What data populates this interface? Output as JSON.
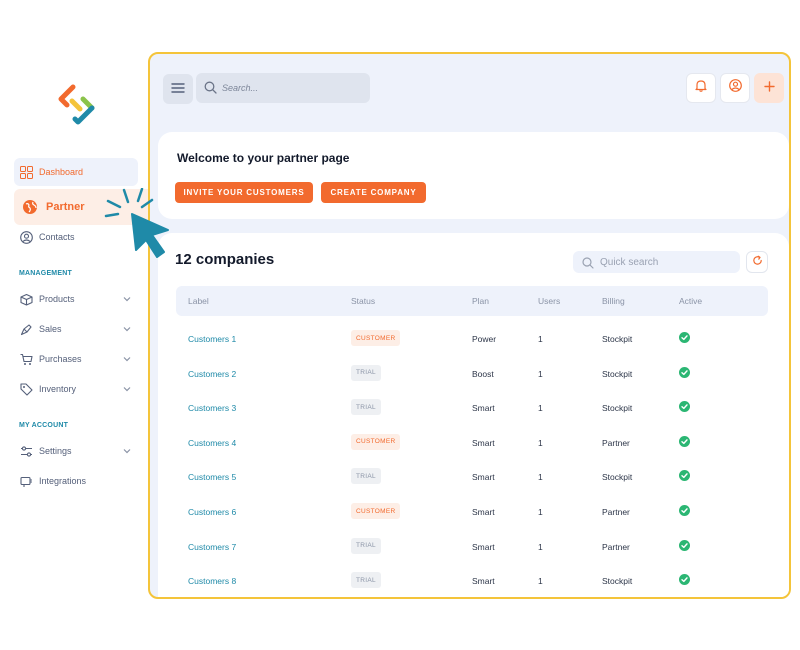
{
  "sidebar": {
    "items": [
      {
        "label": "Dashboard",
        "icon": "grid-icon",
        "active": true
      },
      {
        "label": "Partner",
        "icon": "globe-icon",
        "selected": true
      },
      {
        "label": "Contacts",
        "icon": "user-circle-icon",
        "has_chevron": true
      }
    ],
    "management_title": "MANAGEMENT",
    "management_items": [
      {
        "label": "Products",
        "icon": "box-icon"
      },
      {
        "label": "Sales",
        "icon": "megaphone-icon"
      },
      {
        "label": "Purchases",
        "icon": "cart-icon"
      },
      {
        "label": "Inventory",
        "icon": "tag-icon"
      }
    ],
    "account_title": "MY ACCOUNT",
    "account_items": [
      {
        "label": "Settings",
        "icon": "sliders-icon",
        "has_chevron": true
      },
      {
        "label": "Integrations",
        "icon": "plug-icon",
        "has_chevron": false
      }
    ]
  },
  "header": {
    "search_placeholder": "Search...",
    "icons": [
      "menu-icon",
      "search-icon",
      "bell-icon",
      "user-circle-icon",
      "plus-icon"
    ]
  },
  "welcome": {
    "title": "Welcome to your partner page",
    "invite_button": "INVITE YOUR CUSTOMERS",
    "create_button": "CREATE COMPANY"
  },
  "companies": {
    "title": "12 companies",
    "quick_search_placeholder": "Quick search",
    "columns": [
      "Label",
      "Status",
      "Plan",
      "Users",
      "Billing",
      "Active"
    ],
    "rows": [
      {
        "label": "Customers 1",
        "status": "CUSTOMER",
        "plan": "Power",
        "users": "1",
        "billing": "Stockpit",
        "active": true
      },
      {
        "label": "Customers 2",
        "status": "TRIAL",
        "plan": "Boost",
        "users": "1",
        "billing": "Stockpit",
        "active": true
      },
      {
        "label": "Customers 3",
        "status": "TRIAL",
        "plan": "Smart",
        "users": "1",
        "billing": "Stockpit",
        "active": true
      },
      {
        "label": "Customers 4",
        "status": "CUSTOMER",
        "plan": "Smart",
        "users": "1",
        "billing": "Partner",
        "active": true
      },
      {
        "label": "Customers 5",
        "status": "TRIAL",
        "plan": "Smart",
        "users": "1",
        "billing": "Stockpit",
        "active": true
      },
      {
        "label": "Customers 6",
        "status": "CUSTOMER",
        "plan": "Smart",
        "users": "1",
        "billing": "Partner",
        "active": true
      },
      {
        "label": "Customers 7",
        "status": "TRIAL",
        "plan": "Smart",
        "users": "1",
        "billing": "Partner",
        "active": true
      },
      {
        "label": "Customers 8",
        "status": "TRIAL",
        "plan": "Smart",
        "users": "1",
        "billing": "Stockpit",
        "active": true
      }
    ]
  },
  "colors": {
    "accent": "#f26a2e",
    "link": "#1f8aa8",
    "active_green": "#2bb673",
    "frame_border": "#f4c43a"
  }
}
